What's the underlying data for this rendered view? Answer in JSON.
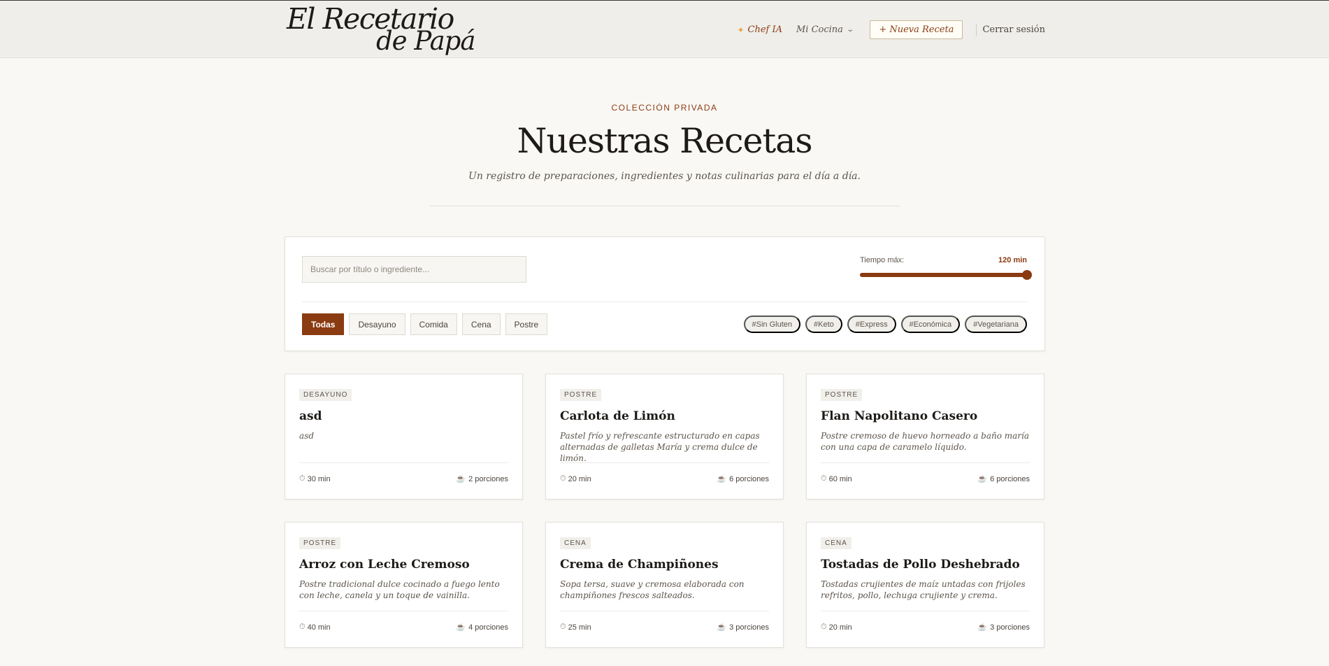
{
  "header": {
    "logo_line1": "El Recetario",
    "logo_line2": "de Papá",
    "nav": {
      "chef_ia": "Chef IA",
      "mi_cocina": "Mi Cocina",
      "nueva_receta": "+ Nueva Receta",
      "cerrar_sesion": "Cerrar sesión"
    }
  },
  "hero": {
    "eyebrow": "COLECCIÓN PRIVADA",
    "title": "Nuestras Recetas",
    "subtitle": "Un registro de preparaciones, ingredientes y notas culinarias para el día a día."
  },
  "filters": {
    "search_placeholder": "Buscar por título o ingrediente...",
    "search_value": "",
    "time_label": "Tiempo máx:",
    "time_value": "120 min",
    "time_fraction": 1.0,
    "categories": [
      "Todas",
      "Desayuno",
      "Comida",
      "Cena",
      "Postre"
    ],
    "active_category": "Todas",
    "tags": [
      "#Sin Gluten",
      "#Keto",
      "#Express",
      "#Económica",
      "#Vegetariana"
    ]
  },
  "recipes": [
    {
      "category": "DESAYUNO",
      "title": "asd",
      "description": "asd",
      "time": "30 min",
      "servings": "2 porciones"
    },
    {
      "category": "POSTRE",
      "title": "Carlota de Limón",
      "description": "Pastel frío y refrescante estructurado en capas alternadas de galletas María y crema dulce de limón.",
      "time": "20 min",
      "servings": "6 porciones"
    },
    {
      "category": "POSTRE",
      "title": "Flan Napolitano Casero",
      "description": "Postre cremoso de huevo horneado a baño maría con una capa de caramelo líquido.",
      "time": "60 min",
      "servings": "6 porciones"
    },
    {
      "category": "POSTRE",
      "title": "Arroz con Leche Cremoso",
      "description": "Postre tradicional dulce cocinado a fuego lento con leche, canela y un toque de vainilla.",
      "time": "40 min",
      "servings": "4 porciones"
    },
    {
      "category": "CENA",
      "title": "Crema de Champiñones",
      "description": "Sopa tersa, suave y cremosa elaborada con champiñones frescos salteados.",
      "time": "25 min",
      "servings": "3 porciones"
    },
    {
      "category": "CENA",
      "title": "Tostadas de Pollo Deshebrado",
      "description": "Tostadas crujientes de maíz untadas con frijoles refritos, pollo, lechuga crujiente y crema.",
      "time": "20 min",
      "servings": "3 porciones"
    }
  ],
  "colors": {
    "accent": "#8a3b12",
    "background": "#f9f8f5",
    "header_bg": "#efeeea"
  },
  "icons": {
    "chef": "sparkle-icon",
    "dropdown": "chevron-down-icon",
    "time": "stopwatch-icon",
    "servings": "dish-icon"
  }
}
